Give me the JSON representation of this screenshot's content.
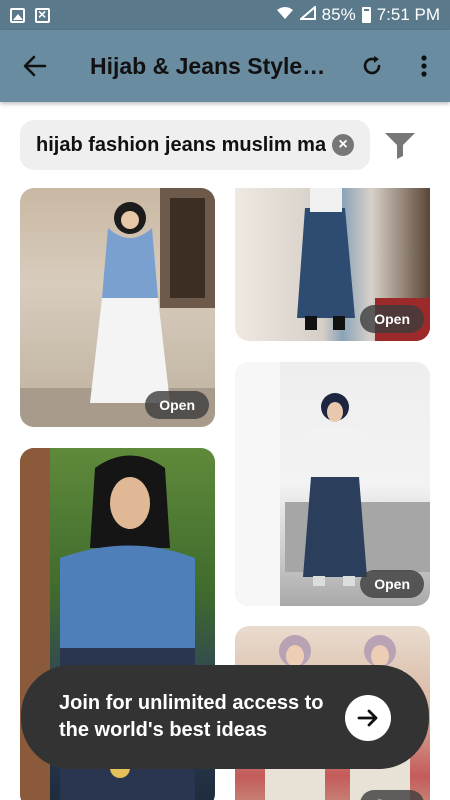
{
  "status_bar": {
    "battery": "85%",
    "time": "7:51 PM"
  },
  "app_bar": {
    "title": "Hijab & Jeans Style…"
  },
  "search": {
    "query": "hijab fashion jeans muslim ma"
  },
  "pins": {
    "open_label": "Open"
  },
  "banner": {
    "text": "Join for unlimited access to the world's best ideas"
  },
  "icons": {
    "back": "arrow-left-icon",
    "refresh": "refresh-icon",
    "more": "more-vert-icon",
    "clear": "clear-icon",
    "filter": "filter-icon",
    "go": "arrow-right-icon"
  },
  "colors": {
    "status_bar": "#5a7a8c",
    "app_bar": "#6a8ca0",
    "banner": "#333333"
  }
}
